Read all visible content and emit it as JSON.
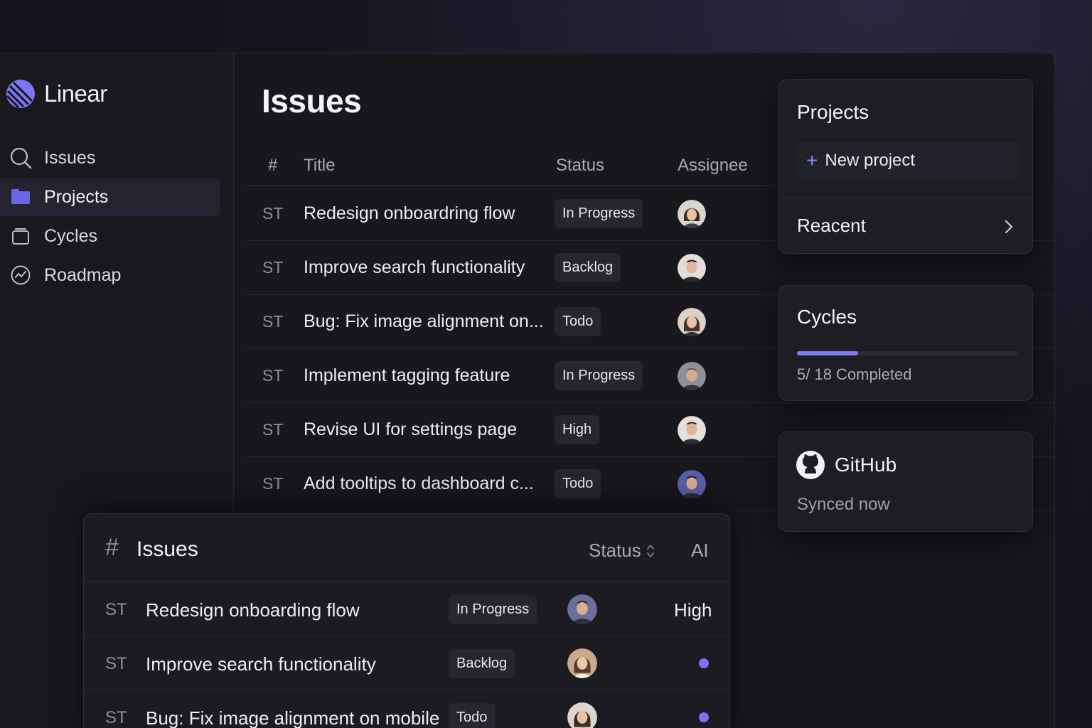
{
  "brand": {
    "name": "Linear"
  },
  "sidebar": {
    "items": [
      {
        "label": "Issues",
        "icon": "search-icon"
      },
      {
        "label": "Projects",
        "icon": "folder-icon",
        "active": true
      },
      {
        "label": "Cycles",
        "icon": "cycles-icon"
      },
      {
        "label": "Roadmap",
        "icon": "roadmap-icon"
      }
    ]
  },
  "main": {
    "title": "Issues",
    "columns": {
      "id": "#",
      "title": "Title",
      "status": "Status",
      "assignee": "Assignee"
    },
    "rows": [
      {
        "id": "ST",
        "title": "Redesign onboardring flow",
        "status": "In Progress"
      },
      {
        "id": "ST",
        "title": "Improve search functionality",
        "status": "Backlog"
      },
      {
        "id": "ST",
        "title": "Bug: Fix image alignment on...",
        "status": "Todo"
      },
      {
        "id": "ST",
        "title": "Implement tagging feature",
        "status": "In Progress"
      },
      {
        "id": "ST",
        "title": "Revise UI for settings page",
        "status": "High"
      },
      {
        "id": "ST",
        "title": "Add tooltips to dashboard c...",
        "status": "Todo"
      }
    ]
  },
  "projects_card": {
    "title": "Projects",
    "new_label": "New project",
    "recent_label": "Reacent"
  },
  "cycles_card": {
    "title": "Cycles",
    "completed": 5,
    "total": 18,
    "progress_text": "5/ 18 Completed"
  },
  "github_card": {
    "title": "GitHub",
    "status": "Synced now"
  },
  "bottom_panel": {
    "hash": "#",
    "title": "Issues",
    "status_label": "Status",
    "extra_col": "AI",
    "rows": [
      {
        "id": "ST",
        "title": "Redesign onboarding flow",
        "status": "In Progress",
        "priority": "High"
      },
      {
        "id": "ST",
        "title": "Improve search functionality",
        "status": "Backlog",
        "priority": ""
      },
      {
        "id": "ST",
        "title": "Bug: Fix image alignment on mobile",
        "status": "Todo",
        "priority": ""
      }
    ]
  },
  "colors": {
    "accent": "#7f7af2",
    "background": "#17171c",
    "card": "#1d1d23"
  }
}
